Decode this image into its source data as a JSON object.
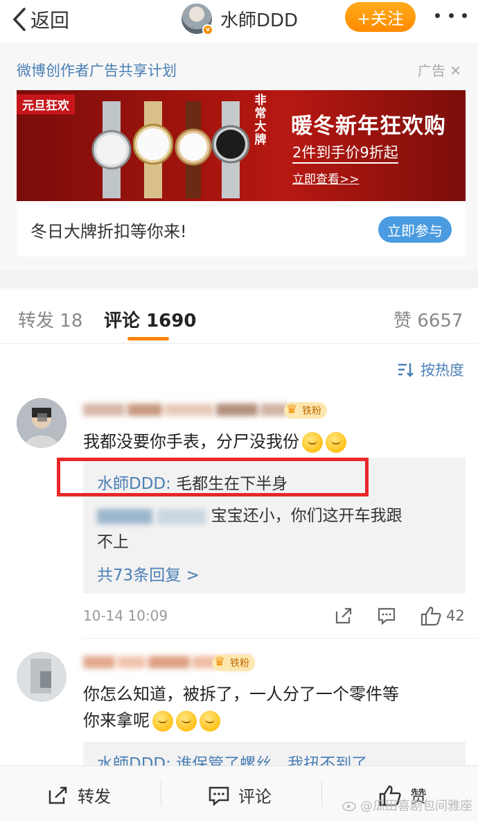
{
  "header": {
    "back_label": "返回",
    "username": "水師DDD",
    "follow_label": "+关注",
    "verified_badge": "v"
  },
  "ad": {
    "sponsor_text": "微博创作者广告共享计划",
    "ad_label": "广告",
    "banner_ribbon": "元旦狂欢",
    "banner_vertical": "非常大牌",
    "banner_title": "暖冬新年狂欢购",
    "banner_subtitle": "2件到手价9折起",
    "banner_link": "立即查看>>",
    "bottom_text": "冬日大牌折扣等你来!",
    "cta_label": "立即参与"
  },
  "tabs": {
    "repost_label": "转发",
    "repost_count": "18",
    "comment_label": "评论",
    "comment_count": "1690",
    "like_label": "赞",
    "like_count": "6657"
  },
  "sort_label": "按热度",
  "comments": [
    {
      "badge": "铁粉",
      "text": "我都没要你手表，分尸没我份",
      "replies": [
        {
          "author": "水師DDD:",
          "text": "毛都生在下半身"
        },
        {
          "text_visible": "宝宝还小，你们这开车我跟",
          "text_line2": "不上"
        }
      ],
      "more_replies": "共73条回复 >",
      "time": "10-14 10:09",
      "likes": "42"
    },
    {
      "badge": "铁粉",
      "text_line1": "你怎么知道，被拆了，一人分了一个零件等",
      "text_line2": "你来拿呢",
      "reply_preview": "水師DDD: 谁保管了螺丝，我扭不到了"
    }
  ],
  "bottombar": {
    "repost_label": "转发",
    "comment_label": "评论",
    "like_label": "赞"
  },
  "watermark": "@瓜田喜剧包间雅座",
  "colors": {
    "accent_orange": "#ff8200",
    "link_blue": "#4a7fb5",
    "highlight_red": "#e9262a"
  }
}
